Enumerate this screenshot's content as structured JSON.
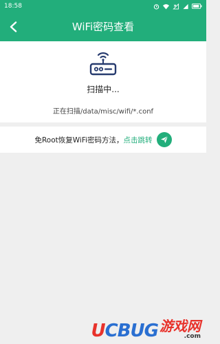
{
  "status_bar": {
    "time": "18:58",
    "icons": [
      "alarm-icon",
      "wifi-icon",
      "sim-x-icon",
      "signal-icon",
      "battery-icon"
    ]
  },
  "header": {
    "title": "WiFi密码查看",
    "back_icon": "back-arrow-icon",
    "color": "#22ae7b"
  },
  "scan": {
    "icon": "router-icon",
    "status": "扫描中...",
    "path": "正在扫描/data/misc/wifi/*.conf"
  },
  "root_tip": {
    "text": "免Root恢复WiFi密码方法，",
    "link": "点击跳转",
    "icon": "send-icon",
    "link_color": "#22ae7b"
  },
  "watermark": {
    "logo_u": "U",
    "logo_rest": "CBUG",
    "cn": "游戏网",
    "domain": ".com"
  }
}
